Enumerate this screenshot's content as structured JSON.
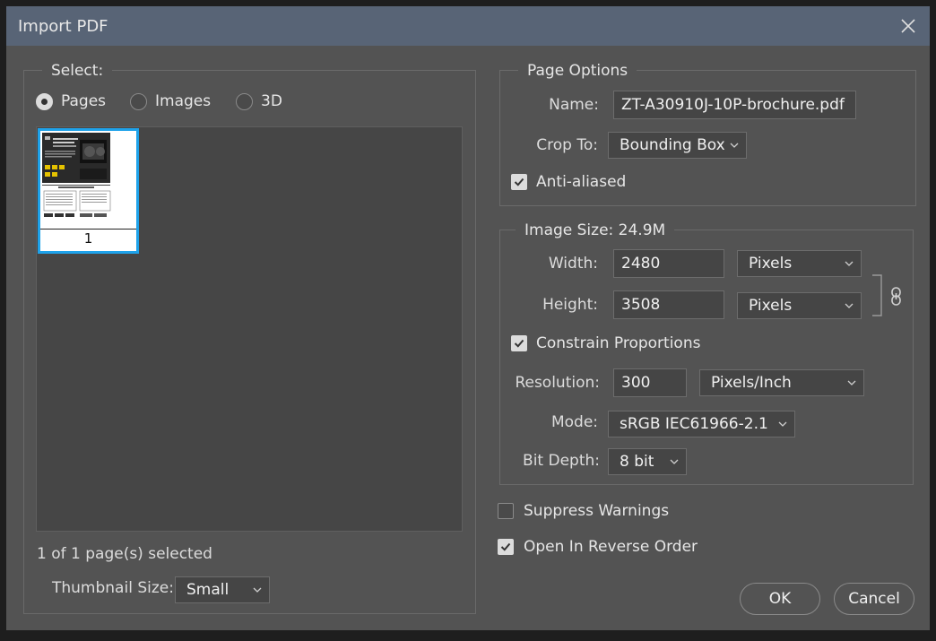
{
  "window": {
    "title": "Import PDF"
  },
  "select": {
    "legend": "Select:",
    "options": [
      {
        "label": "Pages",
        "selected": true
      },
      {
        "label": "Images",
        "selected": false
      },
      {
        "label": "3D",
        "selected": false
      }
    ],
    "thumbnail": {
      "page_number": "1"
    },
    "status": "1 of 1 page(s) selected",
    "thumbnail_size": {
      "label": "Thumbnail Size:",
      "value": "Small"
    }
  },
  "page_options": {
    "legend": "Page Options",
    "name": {
      "label": "Name:",
      "value": "ZT-A30910J-10P-brochure.pdf"
    },
    "crop_to": {
      "label": "Crop To:",
      "value": "Bounding Box"
    },
    "anti_aliased": {
      "label": "Anti-aliased",
      "checked": true
    }
  },
  "image_size": {
    "legend": "Image Size: 24.9M",
    "width": {
      "label": "Width:",
      "value": "2480",
      "unit": "Pixels"
    },
    "height": {
      "label": "Height:",
      "value": "3508",
      "unit": "Pixels"
    },
    "constrain": {
      "label": "Constrain Proportions",
      "checked": true
    },
    "resolution": {
      "label": "Resolution:",
      "value": "300",
      "unit": "Pixels/Inch"
    },
    "mode": {
      "label": "Mode:",
      "value": "sRGB IEC61966-2.1"
    },
    "bit_depth": {
      "label": "Bit Depth:",
      "value": "8 bit"
    }
  },
  "suppress_warnings": {
    "label": "Suppress Warnings",
    "checked": false
  },
  "reverse_order": {
    "label": "Open In Reverse Order",
    "checked": true
  },
  "buttons": {
    "ok": "OK",
    "cancel": "Cancel"
  },
  "colors": {
    "title_bar": "#586476",
    "panel": "#535353",
    "selection": "#1ea2ea"
  }
}
